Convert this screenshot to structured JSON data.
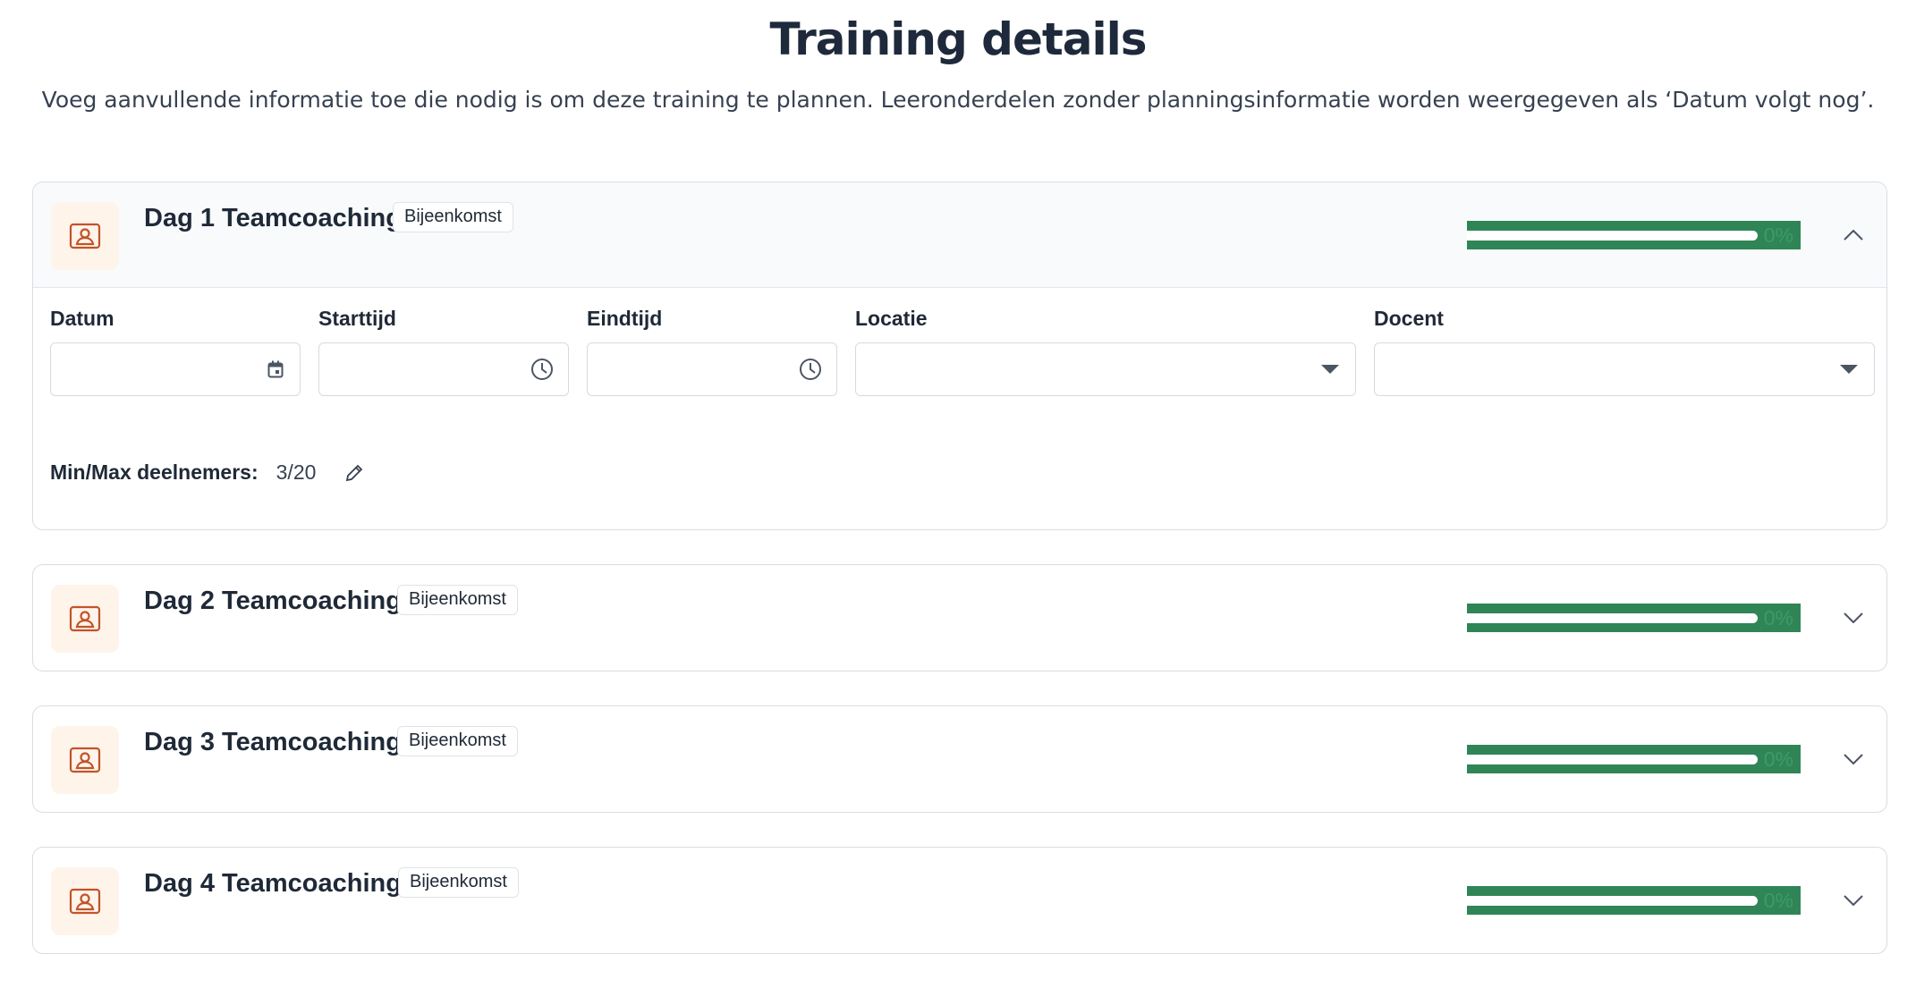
{
  "page": {
    "title": "Training details",
    "subtitle": "Voeg aanvullende informatie toe die nodig is om deze training te plannen. Leeronderdelen zonder planningsinformatie worden weergegeven als ‘Datum volgt nog’."
  },
  "colors": {
    "accent_orange": "#c2532b",
    "icon_bg": "#fff4ea",
    "progress_green": "#2f8556"
  },
  "modules": [
    {
      "title": "Dag 1 Teamcoaching",
      "badge": "Bijeenkomst",
      "progress_label": "0%",
      "progress_value": 0,
      "expanded": true,
      "icon": "presentation-icon",
      "chevron": "chevron-up-icon",
      "fields": {
        "date_label": "Datum",
        "date_value": "",
        "start_label": "Starttijd",
        "start_value": "",
        "end_label": "Eindtijd",
        "end_value": "",
        "location_label": "Locatie",
        "location_value": "",
        "teacher_label": "Docent",
        "teacher_value": ""
      },
      "minmax_label": "Min/Max deelnemers:",
      "minmax_value": "3/20"
    },
    {
      "title": "Dag 2 Teamcoaching",
      "badge": "Bijeenkomst",
      "progress_label": "0%",
      "progress_value": 0,
      "expanded": false,
      "icon": "presentation-icon",
      "chevron": "chevron-down-icon"
    },
    {
      "title": "Dag 3 Teamcoaching",
      "badge": "Bijeenkomst",
      "progress_label": "0%",
      "progress_value": 0,
      "expanded": false,
      "icon": "presentation-icon",
      "chevron": "chevron-down-icon"
    },
    {
      "title": "Dag 4 Teamcoaching",
      "badge": "Bijeenkomst",
      "progress_label": "0%",
      "progress_value": 0,
      "expanded": false,
      "icon": "presentation-icon",
      "chevron": "chevron-down-icon"
    }
  ]
}
